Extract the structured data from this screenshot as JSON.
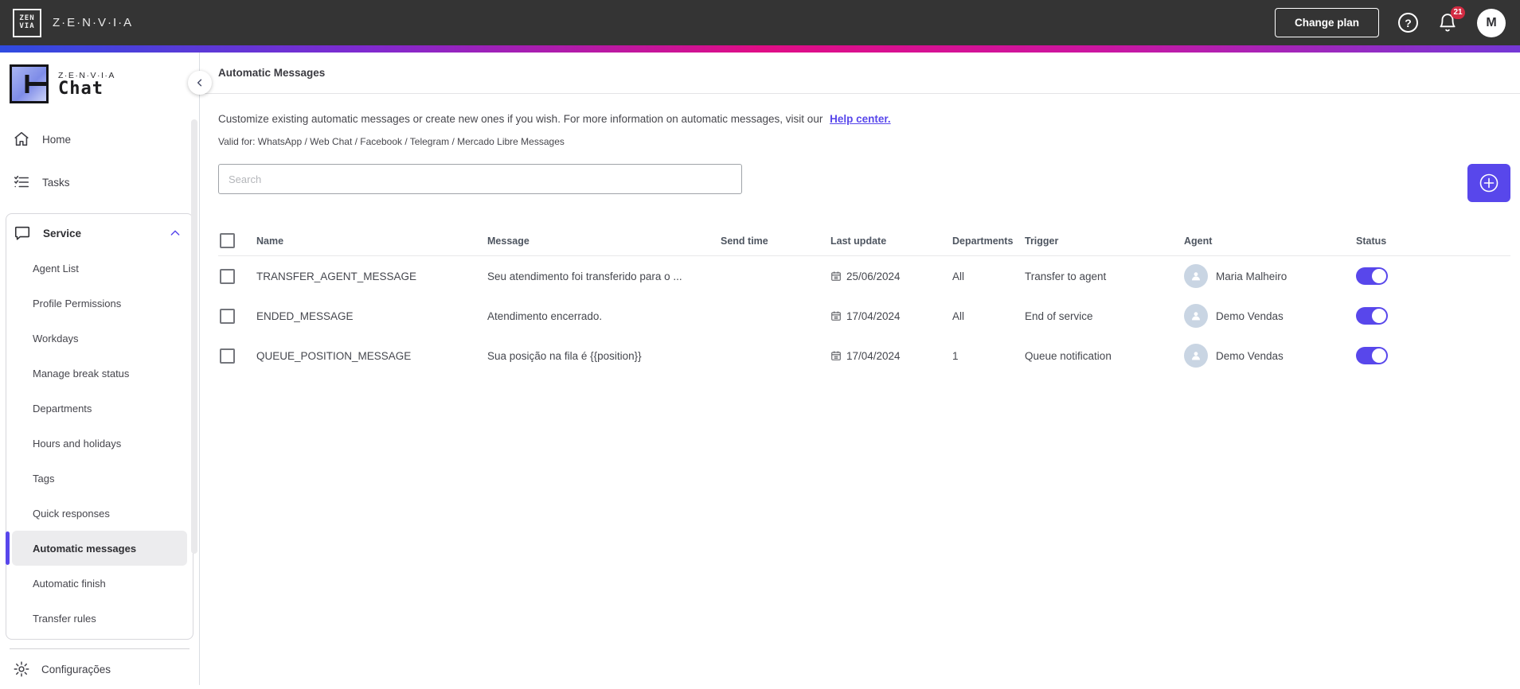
{
  "topbar": {
    "brand": "Z·E·N·V·I·A",
    "logo_line1": "ZEN",
    "logo_line2": "VIA",
    "change_plan_label": "Change plan",
    "help_glyph": "?",
    "notification_count": "21",
    "avatar_initial": "M"
  },
  "sidebar": {
    "logo_brand": "Z·E·N·V·I·A",
    "logo_product": "Chat",
    "home_label": "Home",
    "tasks_label": "Tasks",
    "service_group": {
      "label": "Service",
      "items": [
        "Agent List",
        "Profile Permissions",
        "Workdays",
        "Manage break status",
        "Departments",
        "Hours and holidays",
        "Tags",
        "Quick responses",
        "Automatic messages",
        "Automatic finish",
        "Transfer rules"
      ],
      "selected_item": "Automatic messages"
    },
    "settings_label": "Configurações"
  },
  "page": {
    "title": "Automatic Messages",
    "description": "Customize existing automatic messages or create new ones if you wish. For more information on automatic messages, visit our",
    "help_link_label": "Help center.",
    "valid_for": "Valid for: WhatsApp / Web Chat / Facebook / Telegram / Mercado Libre Messages",
    "search_placeholder": "Search"
  },
  "table": {
    "headers": [
      "Name",
      "Message",
      "Send time",
      "Last update",
      "Departments",
      "Trigger",
      "Agent",
      "Status"
    ],
    "rows": [
      {
        "name": "TRANSFER_AGENT_MESSAGE",
        "message": "Seu atendimento foi transferido para o ...",
        "send_time": "",
        "last_update": "25/06/2024",
        "departments": "All",
        "trigger": "Transfer to agent",
        "agent": "Maria Malheiro",
        "status": "on"
      },
      {
        "name": "ENDED_MESSAGE",
        "message": "Atendimento encerrado.",
        "send_time": "",
        "last_update": "17/04/2024",
        "departments": "All",
        "trigger": "End of service",
        "agent": "Demo Vendas",
        "status": "on"
      },
      {
        "name": "QUEUE_POSITION_MESSAGE",
        "message": "Sua posição na fila é {{position}}",
        "send_time": "",
        "last_update": "17/04/2024",
        "departments": "1",
        "trigger": "Queue notification",
        "agent": "Demo Vendas",
        "status": "on"
      }
    ]
  },
  "icons": {
    "topbar": [
      "zenvia-logo-icon",
      "help-icon",
      "bell-icon"
    ],
    "sidebar": [
      "chat-product-logo",
      "home-icon",
      "tasks-icon",
      "chat-bubble-icon",
      "chevron-up-icon",
      "gear-icon",
      "chevron-left-icon"
    ],
    "table": [
      "calendar-icon",
      "user-avatar-icon",
      "plus-circle-icon"
    ]
  },
  "colors": {
    "accent": "#5847EB",
    "topbar_bg": "#343434",
    "badge_red": "#D22B42",
    "selected_item_bg": "#ECECEE",
    "avatar_bg": "#C9D5E3",
    "gradient": [
      "#2F4BE0",
      "#7F2AD0",
      "#E00D86",
      "#CC15A0",
      "#7438D6"
    ]
  }
}
